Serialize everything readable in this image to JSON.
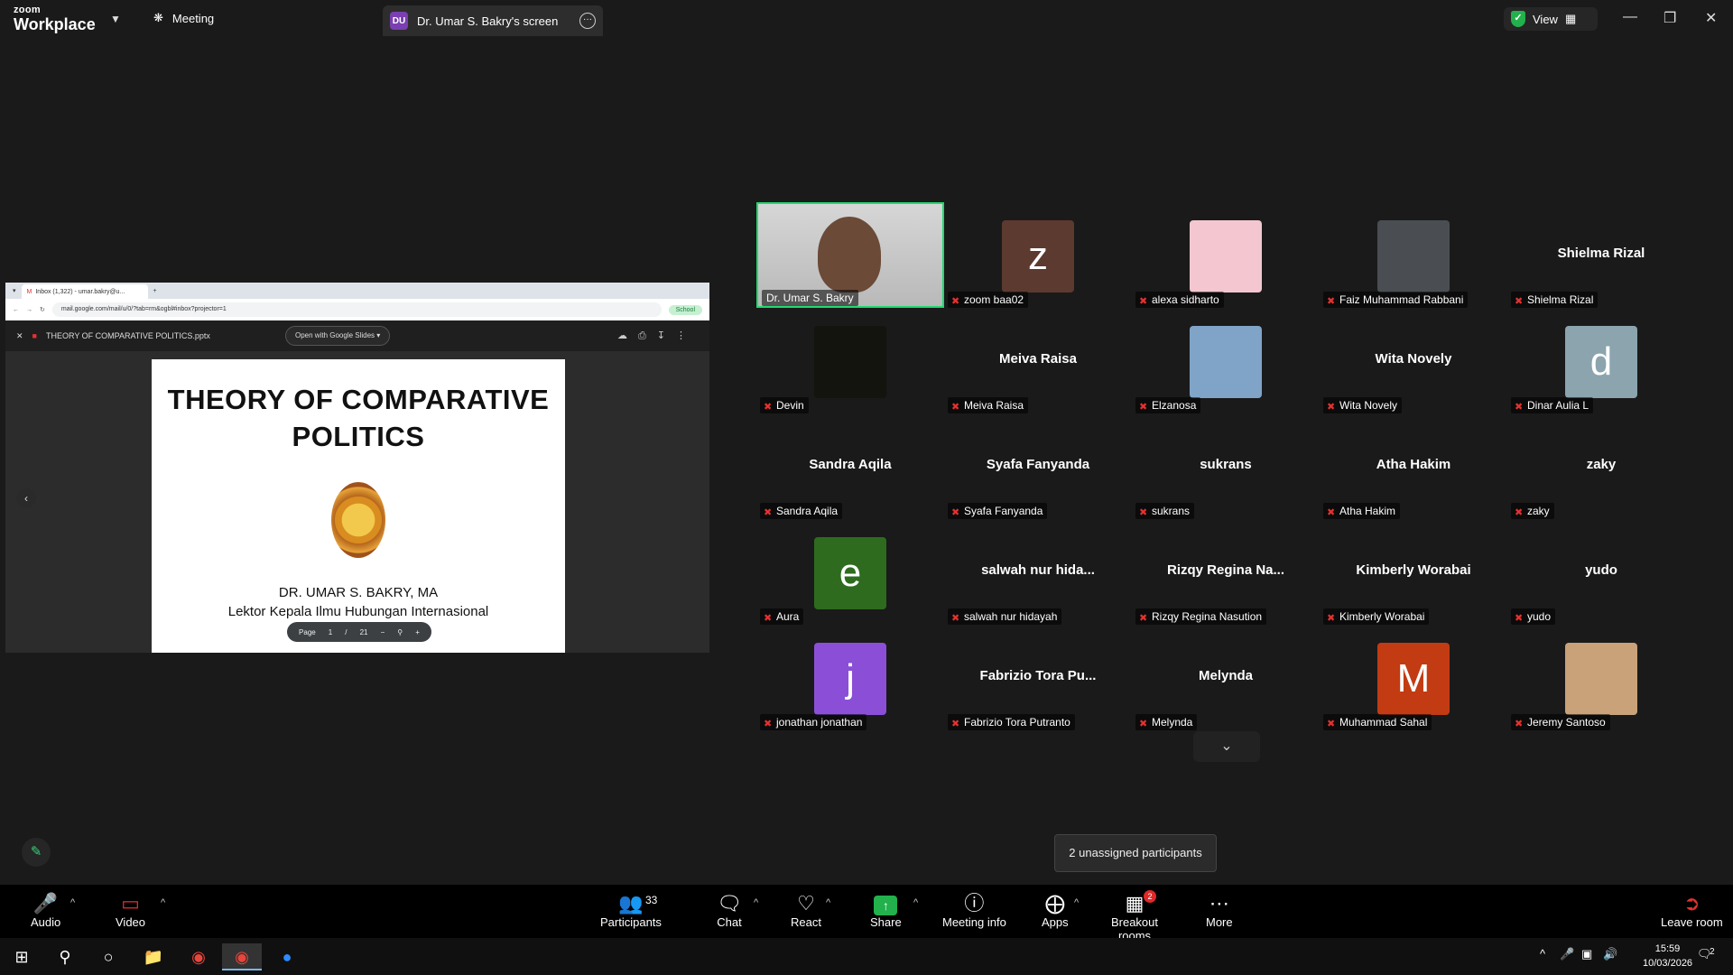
{
  "titlebar": {
    "brand_top": "zoom",
    "brand_bottom": "Workplace",
    "meeting_tab": "Meeting",
    "screen_tab_badge": "DU",
    "screen_tab": "Dr. Umar S. Bakry's screen",
    "view_label": "View"
  },
  "shared_screen": {
    "browser_tab": "Inbox (1,322) - umar.bakry@u...",
    "address": "mail.google.com/mail/u/0/?tab=rm&ogbl#inbox?projector=1",
    "profile": "School",
    "file_name": "THEORY OF COMPARATIVE POLITICS.pptx",
    "open_with": "Open with Google Slides",
    "slide_title": "THEORY OF COMPARATIVE POLITICS",
    "slide_author": "DR. UMAR S. BAKRY, MA",
    "slide_sub": "Lektor Kepala Ilmu Hubungan Internasional",
    "page_label": "Page",
    "page_current": "1",
    "page_sep": "/",
    "page_total": "21"
  },
  "participants_grid": [
    {
      "big": "",
      "tag": "Dr. Umar S. Bakry",
      "type": "video"
    },
    {
      "big": "z",
      "tag": "zoom baa02",
      "type": "letter",
      "color": "#5c3a30"
    },
    {
      "big": "",
      "tag": "alexa sidharto",
      "type": "pic",
      "color": "#f4c6d0"
    },
    {
      "big": "",
      "tag": "Faiz Muhammad Rabbani",
      "type": "pic",
      "color": "#4a4e52"
    },
    {
      "big": "Shielma Rizal",
      "tag": "Shielma Rizal",
      "type": "name"
    },
    {
      "big": "",
      "tag": "Devin",
      "type": "pic",
      "color": "#12140d"
    },
    {
      "big": "Meiva Raisa",
      "tag": "Meiva Raisa",
      "type": "name"
    },
    {
      "big": "",
      "tag": "Elzanosa",
      "type": "pic",
      "color": "#7fa4c8"
    },
    {
      "big": "Wita Novely",
      "tag": "Wita Novely",
      "type": "name"
    },
    {
      "big": "d",
      "tag": "Dinar Aulia L",
      "type": "letter",
      "color": "#8ba4ae"
    },
    {
      "big": "Sandra Aqila",
      "tag": "Sandra Aqila",
      "type": "name"
    },
    {
      "big": "Syafa Fanyanda",
      "tag": "Syafa Fanyanda",
      "type": "name"
    },
    {
      "big": "sukrans",
      "tag": "sukrans",
      "type": "name"
    },
    {
      "big": "Atha Hakim",
      "tag": "Atha Hakim",
      "type": "name"
    },
    {
      "big": "zaky",
      "tag": "zaky",
      "type": "name"
    },
    {
      "big": "e",
      "tag": "Aura",
      "type": "letter",
      "color": "#2e6b1f"
    },
    {
      "big": "salwah nur hida...",
      "tag": "salwah nur hidayah",
      "type": "name"
    },
    {
      "big": "Rizqy Regina Na...",
      "tag": "Rizqy Regina Nasution",
      "type": "name"
    },
    {
      "big": "Kimberly Worabai",
      "tag": "Kimberly Worabai",
      "type": "name"
    },
    {
      "big": "yudo",
      "tag": "yudo",
      "type": "name"
    },
    {
      "big": "j",
      "tag": "jonathan jonathan",
      "type": "letter",
      "color": "#8a4fd6"
    },
    {
      "big": "Fabrizio Tora Pu...",
      "tag": "Fabrizio Tora Putranto",
      "type": "name"
    },
    {
      "big": "Melynda",
      "tag": "Melynda",
      "type": "name"
    },
    {
      "big": "M",
      "tag": "Muhammad Sahal",
      "type": "letter",
      "color": "#c23b12"
    },
    {
      "big": "",
      "tag": "Jeremy Santoso",
      "type": "pic",
      "color": "#c9a27a"
    }
  ],
  "tooltip": "2 unassigned participants",
  "toolbar": {
    "audio": "Audio",
    "video": "Video",
    "participants": "Participants",
    "participants_count": "33",
    "chat": "Chat",
    "react": "React",
    "share": "Share",
    "meeting_info": "Meeting info",
    "apps": "Apps",
    "breakout": "Breakout rooms",
    "breakout_badge": "2",
    "more": "More",
    "leave": "Leave room"
  },
  "taskbar": {
    "time": "15:59",
    "date": "10/03/2026",
    "notif_count": "2"
  }
}
